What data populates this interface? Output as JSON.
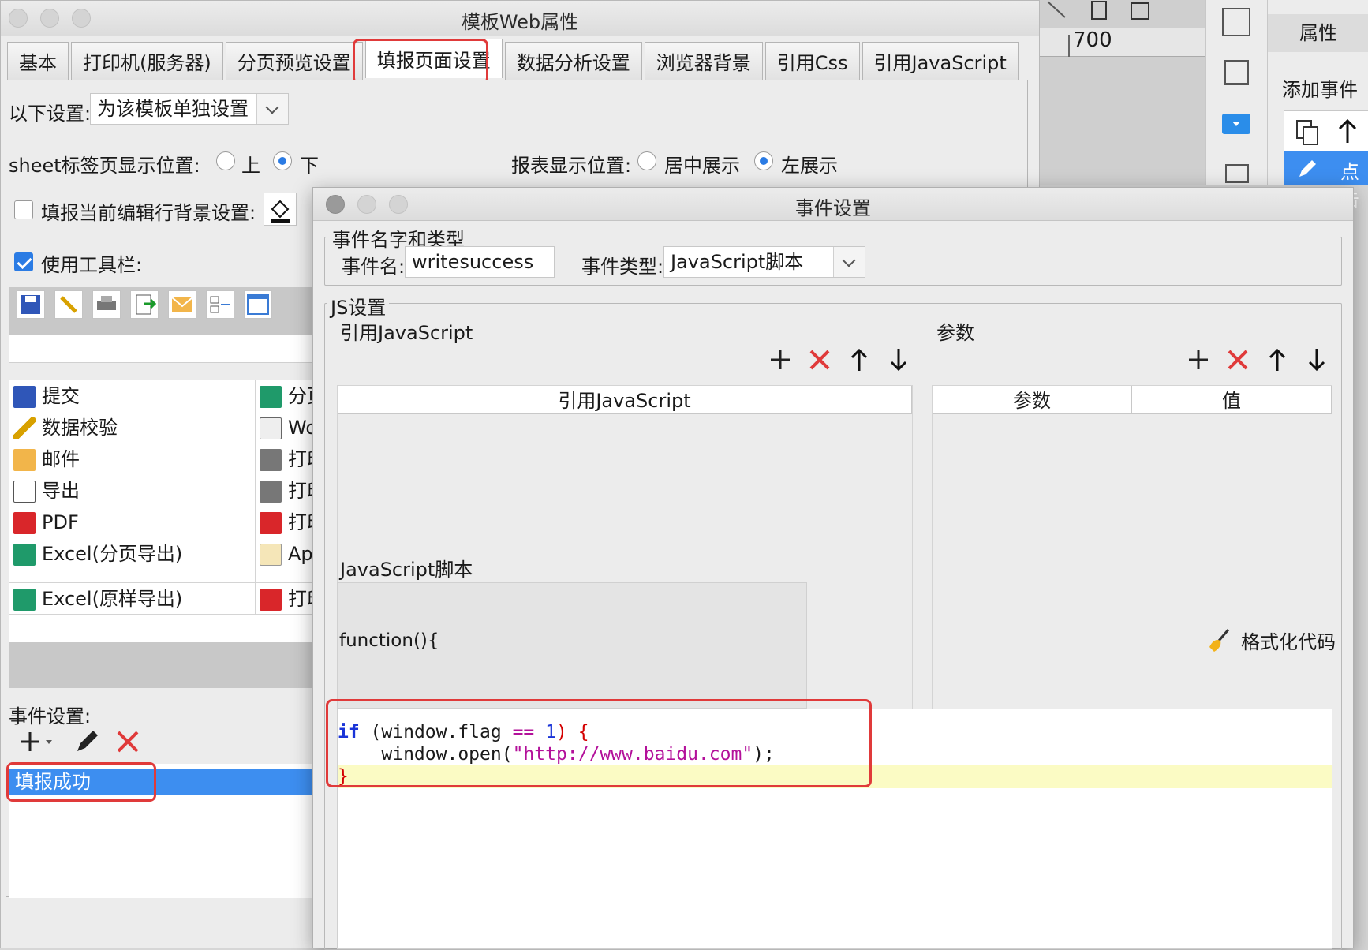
{
  "main_window": {
    "title": "模板Web属性",
    "tabs": [
      "基本",
      "打印机(服务器)",
      "分页预览设置",
      "填报页面设置",
      "数据分析设置",
      "浏览器背景",
      "引用Css",
      "引用JavaScript"
    ],
    "active_tab": "填报页面设置",
    "settings_label": "以下设置:",
    "settings_value": "为该模板单独设置",
    "sheet_pos_label": "sheet标签页显示位置:",
    "sheet_pos_top": "上",
    "sheet_pos_bottom": "下",
    "report_pos_label": "报表显示位置:",
    "report_pos_center": "居中展示",
    "report_pos_left": "左展示",
    "edit_row_bg_label": "填报当前编辑行背景设置:",
    "use_toolbar_label": "使用工具栏:",
    "toolbar_items_left": [
      "提交",
      "数据校验",
      "邮件",
      "导出",
      "PDF",
      "Excel(分页导出)",
      "Excel(原样导出)"
    ],
    "toolbar_items_right": [
      "分页",
      "Wor",
      "打印",
      "打印",
      "打印",
      "App",
      "打印"
    ],
    "event_settings_label": "事件设置:",
    "events": [
      "填报成功"
    ]
  },
  "side": {
    "ruler_value": "700",
    "properties_tab": "属性",
    "add_event": "添加事件",
    "click_label": "点击"
  },
  "dialog": {
    "title": "事件设置",
    "group_name_type": "事件名字和类型",
    "event_name_label": "事件名:",
    "event_name_value": "writesuccess",
    "event_type_label": "事件类型:",
    "event_type_value": "JavaScript脚本",
    "group_js": "JS设置",
    "ref_js_label": "引用JavaScript",
    "ref_js_col": "引用JavaScript",
    "params_label": "参数",
    "params_col": "参数",
    "value_col": "值",
    "script_label": "JavaScript脚本",
    "format_code": "格式化代码",
    "function_header": "function(){",
    "code": {
      "l1_kw": "if",
      "l1_a": " (window.flag ",
      "l1_op": "==",
      "l1_num": " 1",
      "l1_b": ") ",
      "l1_brace": "{",
      "l2_a": "    window.open(",
      "l2_str": "\"http://www.baidu.com\"",
      "l2_b": ");",
      "l3_brace": "}"
    }
  },
  "colors": {
    "highlight_red": "#e03a3a",
    "selection_blue": "#3d8ef0",
    "keyword_blue": "#1a34d8",
    "string_magenta": "#b3109a",
    "current_line": "#fbfbc4"
  }
}
